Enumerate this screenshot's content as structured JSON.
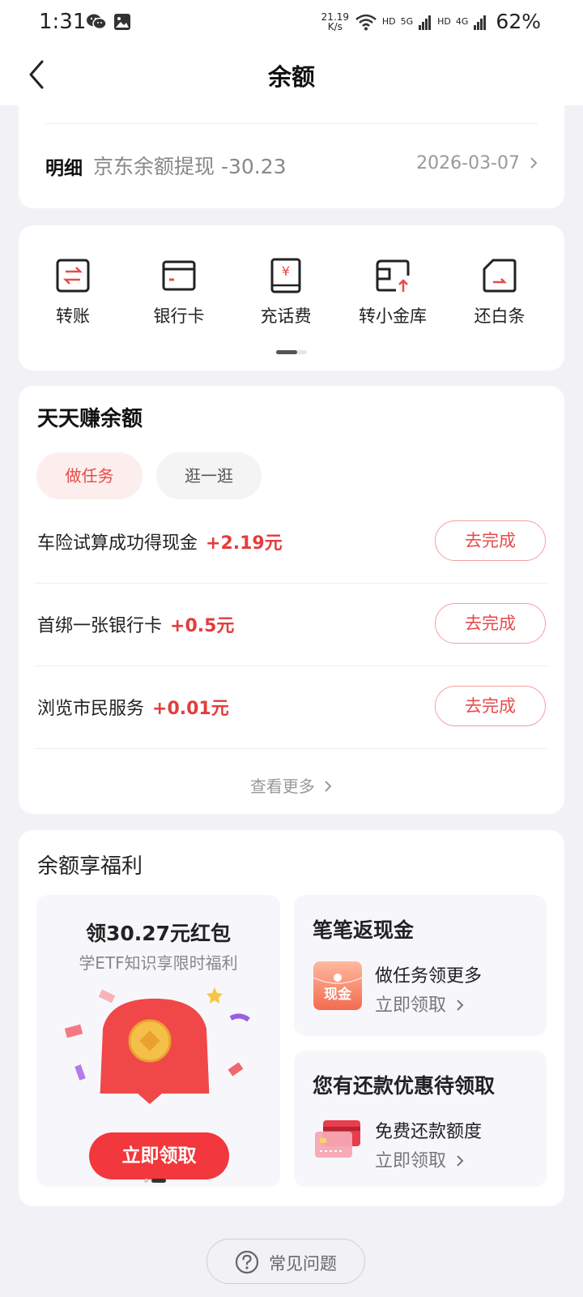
{
  "status": {
    "time": "1:31",
    "net_speed_top": "21.19",
    "net_speed_bottom": "K/s",
    "hd1": "HD",
    "sim1": "5G",
    "hd2": "HD",
    "sim2": "4G",
    "battery": "62%"
  },
  "nav": {
    "title": "余额",
    "back_icon": "chevron-left-icon"
  },
  "detail": {
    "label": "明细",
    "text": "京东余额提现 -30.23",
    "date": "2026-03-07"
  },
  "actions": [
    {
      "label": "转账",
      "icon": "transfer-icon"
    },
    {
      "label": "银行卡",
      "icon": "bank-card-icon"
    },
    {
      "label": "充话费",
      "icon": "phone-recharge-icon"
    },
    {
      "label": "转小金库",
      "icon": "vault-transfer-icon"
    },
    {
      "label": "还白条",
      "icon": "repay-icon"
    }
  ],
  "tasks": {
    "title": "天天赚余额",
    "tab_active": "做任务",
    "tab_inactive": "逛一逛",
    "items": [
      {
        "name": "车险试算成功得现金",
        "reward": "+2.19元",
        "button": "去完成"
      },
      {
        "name": "首绑一张银行卡",
        "reward": "+0.5元",
        "button": "去完成"
      },
      {
        "name": "浏览市民服务",
        "reward": "+0.01元",
        "button": "去完成"
      }
    ],
    "more": "查看更多"
  },
  "benefits": {
    "title": "余额享福利",
    "left": {
      "main": "领30.27元红包",
      "sub": "学ETF知识享限时福利",
      "button": "立即领取"
    },
    "right1": {
      "title": "笔笔返现金",
      "icon_text": "现金",
      "line1": "做任务领更多",
      "line2": "立即领取"
    },
    "right2": {
      "title": "您有还款优惠待领取",
      "line1": "免费还款额度",
      "line2": "立即领取"
    }
  },
  "faq": {
    "label": "常见问题"
  },
  "colors": {
    "accent": "#e84a4a",
    "bg": "#f2f2f6",
    "button_red": "#f2383c"
  }
}
